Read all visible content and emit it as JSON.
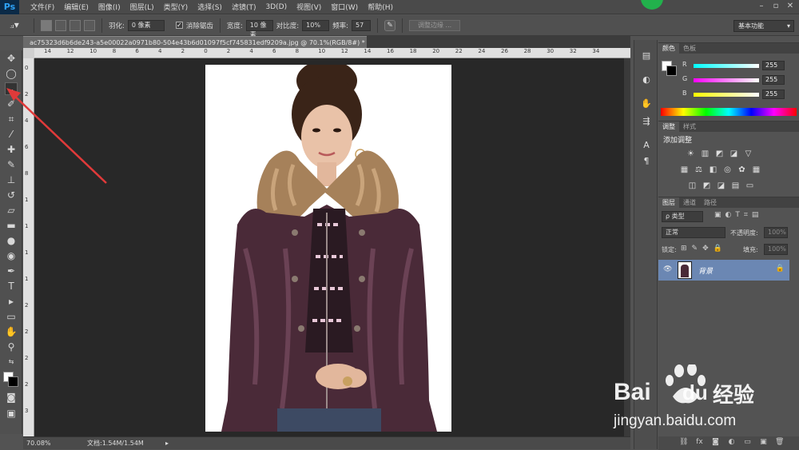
{
  "app": {
    "logo": "Ps"
  },
  "menu": [
    "文件(F)",
    "编辑(E)",
    "图像(I)",
    "图层(L)",
    "类型(Y)",
    "选择(S)",
    "滤镜(T)",
    "3D(D)",
    "视图(V)",
    "窗口(W)",
    "帮助(H)"
  ],
  "options": {
    "feather_label": "羽化:",
    "feather_value": "0 像素",
    "antialias_label": "消除锯齿",
    "width_label": "宽度:",
    "width_value": "10 像素",
    "contrast_label": "对比度:",
    "contrast_value": "10%",
    "frequency_label": "频率:",
    "frequency_value": "57",
    "refine_edge_label": "调整边缘 ...",
    "workspace": "基本功能"
  },
  "document": {
    "tab_title": "ac75323d6b6de243-a5e00022a0971b80-504e43b6d01097f5cf745831edf9209a.jpg @ 70.1%(RGB/8#) *",
    "ruler_h": [
      "14",
      "12",
      "10",
      "8",
      "6",
      "4",
      "2",
      "0",
      "2",
      "4",
      "6",
      "8",
      "10",
      "12",
      "14",
      "16",
      "18",
      "20",
      "22",
      "24",
      "26",
      "28",
      "30",
      "32",
      "34"
    ],
    "ruler_v": [
      "0",
      "2",
      "4",
      "6",
      "8",
      "1",
      "1",
      "1",
      "1",
      "2",
      "2",
      "2",
      "2",
      "3"
    ]
  },
  "status": {
    "zoom": "70.08%",
    "doc_info": "文档:1.54M/1.54M"
  },
  "color_panel": {
    "tabs": [
      "颜色",
      "色板"
    ],
    "channels": [
      {
        "label": "R",
        "value": "255"
      },
      {
        "label": "G",
        "value": "255"
      },
      {
        "label": "B",
        "value": "255"
      }
    ]
  },
  "adjust_panel": {
    "tabs": [
      "调整",
      "样式"
    ],
    "heading": "添加调整"
  },
  "layers_panel": {
    "tabs": [
      "图层",
      "通道",
      "路径"
    ],
    "filter_kind": "ρ 类型",
    "blend_mode": "正常",
    "opacity_label": "不透明度:",
    "opacity_value": "100%",
    "lock_label": "锁定:",
    "fill_label": "填充:",
    "fill_value": "100%",
    "layer_name": "背景"
  },
  "watermark": {
    "brand": "Bai",
    "brand2": "du",
    "cn": "经验",
    "url": "jingyan.baidu.com"
  },
  "colors": {
    "accent_red": "#e03a3a",
    "selected_layer": "#6b87b3"
  }
}
